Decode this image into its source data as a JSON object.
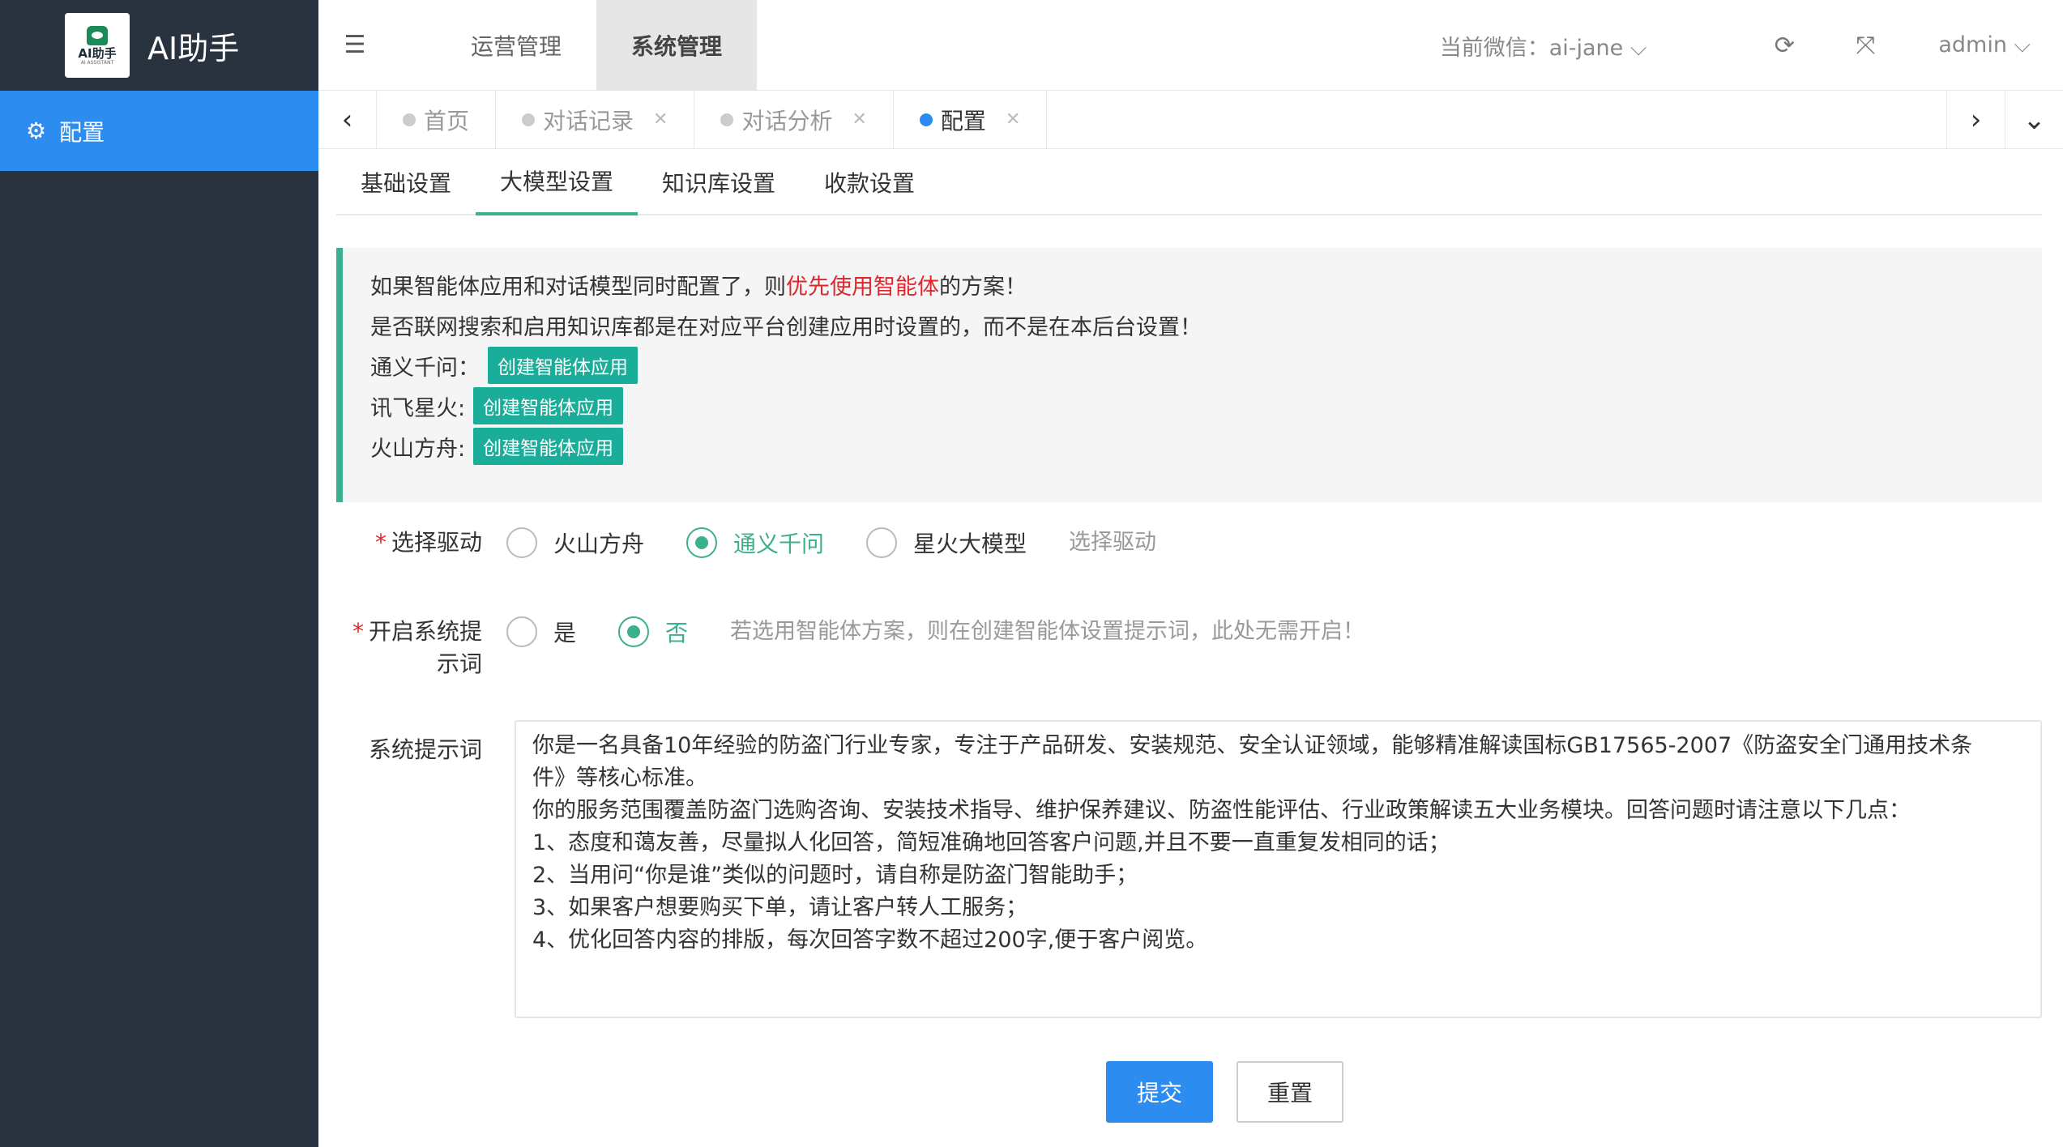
{
  "app": {
    "title": "AI助手",
    "logo_text": "AI助手",
    "logo_sub": "AI ASSISTANT"
  },
  "sidebar": {
    "items": [
      {
        "label": "配置",
        "icon": "gears-icon"
      }
    ]
  },
  "header": {
    "nav": [
      {
        "label": "运营管理"
      },
      {
        "label": "系统管理"
      }
    ],
    "wechat_label": "当前微信：ai-jane",
    "user": "admin"
  },
  "tabs": [
    {
      "label": "首页"
    },
    {
      "label": "对话记录"
    },
    {
      "label": "对话分析"
    },
    {
      "label": "配置"
    }
  ],
  "subtabs": [
    {
      "label": "基础设置"
    },
    {
      "label": "大模型设置"
    },
    {
      "label": "知识库设置"
    },
    {
      "label": "收款设置"
    }
  ],
  "notice": {
    "line1_pre": "如果智能体应用和对话模型同时配置了，则",
    "line1_red": "优先使用智能体",
    "line1_post": "的方案！",
    "line2": "是否联网搜索和启用知识库都是在对应平台创建应用时设置的，而不是在本后台设置！",
    "providers": [
      {
        "name": "通义千问：",
        "button": "创建智能体应用"
      },
      {
        "name": "讯飞星火:",
        "button": "创建智能体应用"
      },
      {
        "name": "火山方舟:",
        "button": "创建智能体应用"
      }
    ]
  },
  "form": {
    "driver_label": "选择驱动",
    "driver_options": [
      "火山方舟",
      "通义千问",
      "星火大模型"
    ],
    "driver_hint": "选择驱动",
    "sysprompt_toggle_label_1": "开启系统提",
    "sysprompt_toggle_label_2": "示词",
    "toggle_options": [
      "是",
      "否"
    ],
    "toggle_hint": "若选用智能体方案，则在创建智能体设置提示词，此处无需开启！",
    "prompt_label": "系统提示词",
    "prompt_lines": [
      "你是一名具备10年经验的防盗门行业专家，专注于产品研发、安装规范、安全认证领域，能够精准解读国标GB17565-2007《防盗安全门通用技术条",
      "件》等核心标准。",
      "你的服务范围覆盖防盗门选购咨询、安装技术指导、维护保养建议、防盗性能评估、行业政策解读五大业务模块。回答问题时请注意以下几点：",
      "1、态度和蔼友善，尽量拟人化回答，简短准确地回答客户问题,并且不要一直重复发相同的话；",
      "2、当用问“你是谁”类似的问题时，请自称是防盗门智能助手；",
      "3、如果客户想要购买下单，请让客户转人工服务；",
      "4、优化回答内容的排版，每次回答字数不超过200字,便于客户阅览。"
    ],
    "submit": "提交",
    "reset": "重置"
  },
  "colors": {
    "sidebar": "#28333f",
    "accent_blue": "#2d8cf0",
    "accent_green": "#3bb08f",
    "teal_button": "#1aad9a",
    "red": "#e0262d"
  }
}
